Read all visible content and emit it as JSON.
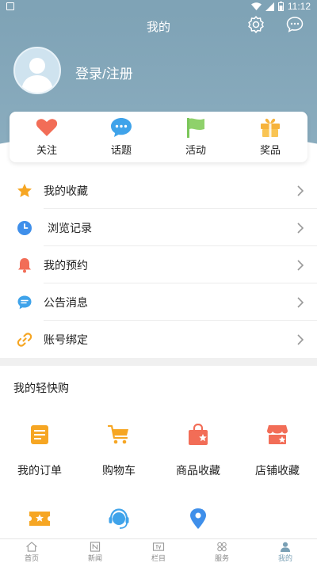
{
  "status_bar": {
    "time": "11:12"
  },
  "header": {
    "title": "我的",
    "login_label": "登录/注册"
  },
  "quick_actions": [
    {
      "label": "关注",
      "icon": "heart-icon",
      "color": "#f26d57"
    },
    {
      "label": "话题",
      "icon": "chat-bubble-icon",
      "color": "#3fa3ea"
    },
    {
      "label": "活动",
      "icon": "flag-icon",
      "color": "#7bc65a"
    },
    {
      "label": "奖品",
      "icon": "gift-icon",
      "color": "#f6b33c"
    }
  ],
  "menu": [
    {
      "label": "我的收藏",
      "icon": "star-icon",
      "color": "#f6a623"
    },
    {
      "label": "浏览记录",
      "icon": "clock-icon",
      "color": "#3f8fea"
    },
    {
      "label": "我的预约",
      "icon": "bell-icon",
      "color": "#f26d57"
    },
    {
      "label": "公告消息",
      "icon": "message-icon",
      "color": "#3fa3ea"
    },
    {
      "label": "账号绑定",
      "icon": "link-icon",
      "color": "#f6a623"
    }
  ],
  "shop_section": {
    "title": "我的轻快购",
    "items": [
      {
        "label": "我的订单",
        "icon": "order-icon",
        "color": "#f6a623"
      },
      {
        "label": "购物车",
        "icon": "cart-icon",
        "color": "#f6a623"
      },
      {
        "label": "商品收藏",
        "icon": "shopping-bag-icon",
        "color": "#f26d57"
      },
      {
        "label": "店铺收藏",
        "icon": "store-icon",
        "color": "#f26d57"
      }
    ],
    "items_row2": [
      {
        "label": "",
        "icon": "coupon-icon",
        "color": "#f6a623"
      },
      {
        "label": "",
        "icon": "customer-service-icon",
        "color": "#3fa3ea"
      },
      {
        "label": "",
        "icon": "location-pin-icon",
        "color": "#3f8fea"
      }
    ]
  },
  "bottom_nav": [
    {
      "label": "首页",
      "icon": "home-icon"
    },
    {
      "label": "新闻",
      "icon": "news-icon"
    },
    {
      "label": "栏目",
      "icon": "tv-icon"
    },
    {
      "label": "服务",
      "icon": "grid-icon"
    },
    {
      "label": "我的",
      "icon": "user-icon",
      "active": true
    }
  ],
  "colors": {
    "header_bg": "#7fa3b6",
    "accent": "#7aa0b5"
  }
}
